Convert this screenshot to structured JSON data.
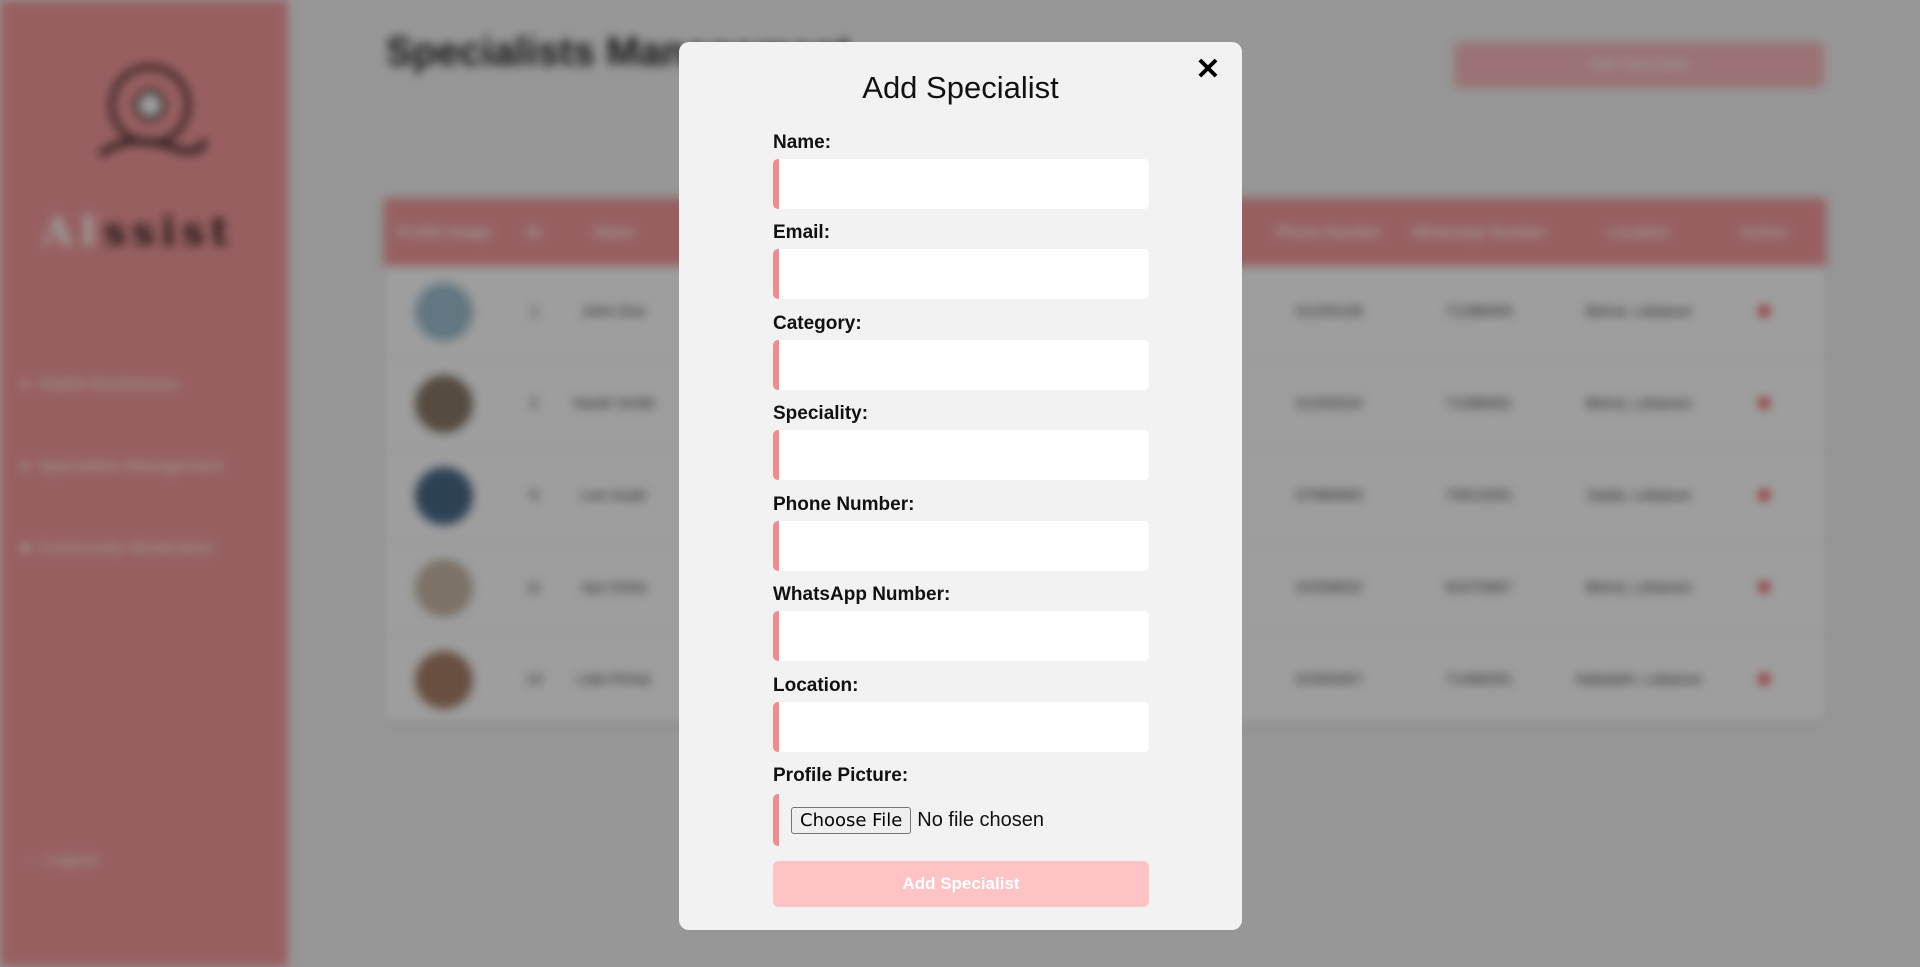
{
  "sidebar": {
    "logo_prefix": "AI",
    "logo_suffix": "ssist",
    "items": [
      {
        "label": "Stable Businesses"
      },
      {
        "label": "Specialists Management"
      },
      {
        "label": "Community Moderation"
      }
    ],
    "logout_label": "Logout"
  },
  "page": {
    "title": "Specialists Management",
    "add_button_label": "Add Specialist"
  },
  "table": {
    "headers": [
      "Profile Image",
      "ID",
      "Name",
      "Phone Number",
      "WhatsApp Number",
      "Location",
      "Action"
    ],
    "rows": [
      {
        "id": "1",
        "name": "John Doe",
        "phone": "01234128",
        "whatsapp": "71288493",
        "location": "Beirut, Lebanon"
      },
      {
        "id": "2",
        "name": "Sarah Smith",
        "phone": "01293224",
        "whatsapp": "71288491",
        "location": "Beirut, Lebanon"
      },
      {
        "id": "9",
        "name": "Lee Issah",
        "phone": "07989993",
        "whatsapp": "70613291",
        "location": "Saida, Lebanon"
      },
      {
        "id": "11",
        "name": "Ayo Doha",
        "phone": "01939622",
        "whatsapp": "81570967",
        "location": "Beirut, Lebanon"
      },
      {
        "id": "14",
        "name": "Lida Pichai",
        "phone": "01993467",
        "whatsapp": "71486291",
        "location": "Nabatieh, Lebanon"
      }
    ]
  },
  "modal": {
    "title": "Add Specialist",
    "close_symbol": "✕",
    "fields": [
      {
        "label": "Name:",
        "value": ""
      },
      {
        "label": "Email:",
        "value": ""
      },
      {
        "label": "Category:",
        "value": ""
      },
      {
        "label": "Speciality:",
        "value": ""
      },
      {
        "label": "Phone Number:",
        "value": ""
      },
      {
        "label": "WhatsApp Number:",
        "value": ""
      },
      {
        "label": "Location:",
        "value": ""
      }
    ],
    "file_label": "Profile Picture:",
    "choose_file_label": "Choose File",
    "no_file_text": "No file chosen",
    "submit_label": "Add Specialist"
  },
  "colors": {
    "sidebar": "#f49a9c",
    "accent_border": "#ef8c8e",
    "submit_disabled": "#fec3c4",
    "modal_bg": "#f1f2f1"
  }
}
